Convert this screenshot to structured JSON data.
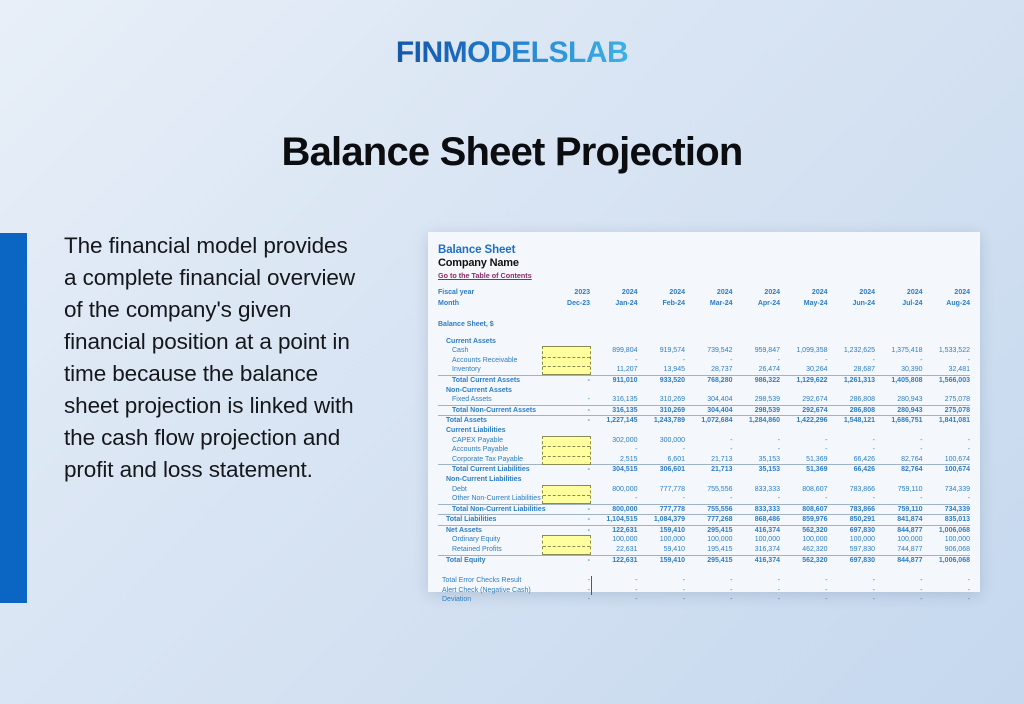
{
  "brand": {
    "logo_text": "FINMODELSLAB"
  },
  "page": {
    "title": "Balance Sheet Projection",
    "description": "The financial model provides a complete financial overview of the company's given financial position at a point in time because the balance sheet projection is linked with the cash flow projection and profit and loss statement.",
    "accent_color": "#0a66c2",
    "background_color": "#dbe6f4"
  },
  "spreadsheet": {
    "title": "Balance Sheet",
    "company": "Company Name",
    "toc_link": "Go to the Table of Contents",
    "fiscal_year_label": "Fiscal year",
    "month_label": "Month",
    "section_title": "Balance Sheet, $",
    "years": [
      "2023",
      "2024",
      "2024",
      "2024",
      "2024",
      "2024",
      "2024",
      "2024",
      "2024"
    ],
    "months": [
      "Dec-23",
      "Jan-24",
      "Feb-24",
      "Mar-24",
      "Apr-24",
      "May-24",
      "Jun-24",
      "Jul-24",
      "Aug-24"
    ],
    "rows": [
      {
        "label": "Current Assets",
        "type": "group",
        "values": []
      },
      {
        "label": "Cash",
        "type": "item",
        "input": true,
        "values": [
          "",
          "899,804",
          "919,574",
          "739,542",
          "959,847",
          "1,099,358",
          "1,232,625",
          "1,375,418",
          "1,533,522"
        ]
      },
      {
        "label": "Accounts Receivable",
        "type": "item",
        "input": true,
        "values": [
          "",
          "-",
          "-",
          "-",
          "-",
          "-",
          "-",
          "-",
          "-"
        ]
      },
      {
        "label": "Inventory",
        "type": "item",
        "input": true,
        "values": [
          "",
          "11,207",
          "13,945",
          "28,737",
          "26,474",
          "30,264",
          "28,687",
          "30,390",
          "32,481"
        ]
      },
      {
        "label": "Total Current Assets",
        "type": "total",
        "rule": "top",
        "values": [
          "-",
          "911,010",
          "933,520",
          "768,280",
          "986,322",
          "1,129,622",
          "1,261,313",
          "1,405,808",
          "1,566,003"
        ]
      },
      {
        "label": "Non-Current Assets",
        "type": "group",
        "values": []
      },
      {
        "label": "Fixed Assets",
        "type": "item",
        "values": [
          "-",
          "316,135",
          "310,269",
          "304,404",
          "298,539",
          "292,674",
          "286,808",
          "280,943",
          "275,078"
        ]
      },
      {
        "label": "Total Non-Current Assets",
        "type": "total",
        "rule": "top",
        "values": [
          "-",
          "316,135",
          "310,269",
          "304,404",
          "298,539",
          "292,674",
          "286,808",
          "280,943",
          "275,078"
        ]
      },
      {
        "label": "Total Assets",
        "type": "grandtotal",
        "rule": "top",
        "values": [
          "-",
          "1,227,145",
          "1,243,789",
          "1,072,684",
          "1,284,860",
          "1,422,296",
          "1,548,121",
          "1,686,751",
          "1,841,081"
        ]
      },
      {
        "label": "Current Liabilities",
        "type": "group",
        "values": []
      },
      {
        "label": "CAPEX Payable",
        "type": "item",
        "input": true,
        "values": [
          "",
          "302,000",
          "300,000",
          "-",
          "-",
          "-",
          "-",
          "-",
          "-"
        ]
      },
      {
        "label": "Accounts Payable",
        "type": "item",
        "input": true,
        "values": [
          "",
          "-",
          "-",
          "-",
          "-",
          "-",
          "-",
          "-",
          "-"
        ]
      },
      {
        "label": "Corporate Tax Payable",
        "type": "item",
        "input": true,
        "values": [
          "",
          "2,515",
          "6,601",
          "21,713",
          "35,153",
          "51,369",
          "66,426",
          "82,764",
          "100,674"
        ]
      },
      {
        "label": "Total Current Liabilities",
        "type": "total",
        "rule": "top",
        "values": [
          "-",
          "304,515",
          "306,601",
          "21,713",
          "35,153",
          "51,369",
          "66,426",
          "82,764",
          "100,674"
        ]
      },
      {
        "label": "Non-Current Liabilities",
        "type": "group",
        "values": []
      },
      {
        "label": "Debt",
        "type": "item",
        "input": true,
        "values": [
          "",
          "800,000",
          "777,778",
          "755,556",
          "833,333",
          "808,607",
          "783,866",
          "759,110",
          "734,339"
        ]
      },
      {
        "label": "Other Non-Current Liabilities",
        "type": "item",
        "input": true,
        "values": [
          "",
          "-",
          "-",
          "-",
          "-",
          "-",
          "-",
          "-",
          "-"
        ]
      },
      {
        "label": "Total Non-Current Liabilities",
        "type": "total",
        "rule": "top",
        "values": [
          "-",
          "800,000",
          "777,778",
          "755,556",
          "833,333",
          "808,607",
          "783,866",
          "759,110",
          "734,339"
        ]
      },
      {
        "label": "Total Liabilities",
        "type": "grandtotal",
        "rule": "top",
        "values": [
          "-",
          "1,104,515",
          "1,084,379",
          "777,268",
          "868,486",
          "859,976",
          "850,291",
          "841,874",
          "835,013"
        ]
      },
      {
        "label": "Net Assets",
        "type": "grandtotal",
        "rule": "top",
        "values": [
          "-",
          "122,631",
          "159,410",
          "295,415",
          "416,374",
          "562,320",
          "697,830",
          "844,877",
          "1,006,068"
        ]
      },
      {
        "label": "Ordinary Equity",
        "type": "item",
        "input": true,
        "values": [
          "",
          "100,000",
          "100,000",
          "100,000",
          "100,000",
          "100,000",
          "100,000",
          "100,000",
          "100,000"
        ]
      },
      {
        "label": "Retained Profits",
        "type": "item",
        "input": true,
        "values": [
          "",
          "22,631",
          "59,410",
          "195,415",
          "316,374",
          "462,320",
          "597,830",
          "744,877",
          "906,068"
        ]
      },
      {
        "label": "Total Equity",
        "type": "grandtotal",
        "rule": "top",
        "values": [
          "-",
          "122,631",
          "159,410",
          "295,415",
          "416,374",
          "562,320",
          "697,830",
          "844,877",
          "1,006,068"
        ]
      },
      {
        "label": "Total Error Checks Result",
        "type": "check",
        "spacer_before": true,
        "values": [
          "-",
          "-",
          "-",
          "-",
          "-",
          "-",
          "-",
          "-",
          "-"
        ]
      },
      {
        "label": "Alert Check (Negative Cash)",
        "type": "check",
        "values": [
          "-",
          "-",
          "-",
          "-",
          "-",
          "-",
          "-",
          "-",
          "-"
        ]
      },
      {
        "label": "Deviation",
        "type": "check",
        "values": [
          "-",
          "-",
          "-",
          "-",
          "-",
          "-",
          "-",
          "-",
          "-"
        ]
      }
    ]
  }
}
